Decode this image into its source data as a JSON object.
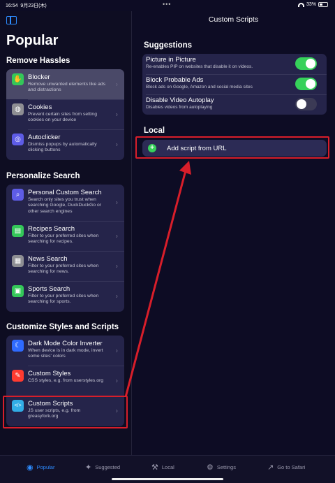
{
  "status": {
    "time": "16:54",
    "date": "9月23日(木)",
    "battery": "33%"
  },
  "sidebar": {
    "title": "Popular",
    "sections": [
      {
        "title": "Remove Hassles",
        "items": [
          {
            "title": "Blocker",
            "subtitle": "Remove unwanted elements like ads and distractions",
            "icon": "hand-icon",
            "selected": true
          },
          {
            "title": "Cookies",
            "subtitle": "Prevent certain sites from setting cookies on your device",
            "icon": "globe-icon"
          },
          {
            "title": "Autoclicker",
            "subtitle": "Dismiss popups by automatically clicking buttons",
            "icon": "tap-icon"
          }
        ]
      },
      {
        "title": "Personalize Search",
        "items": [
          {
            "title": "Personal Custom Search",
            "subtitle": "Search only sites you trust when searching Google, DuckDuckGo or other search engines",
            "icon": "search-icon"
          },
          {
            "title": "Recipes Search",
            "subtitle": "Filter to your preferred sites when searching for recipes.",
            "icon": "recipe-icon"
          },
          {
            "title": "News Search",
            "subtitle": "Filter to your preferred sites when searching for news.",
            "icon": "news-icon"
          },
          {
            "title": "Sports Search",
            "subtitle": "Filter to your preferred sites when searching for sports.",
            "icon": "sports-icon"
          }
        ]
      },
      {
        "title": "Customize Styles and Scripts",
        "items": [
          {
            "title": "Dark Mode Color Inverter",
            "subtitle": "When device is in dark mode, invert some sites' colors",
            "icon": "moon-icon"
          },
          {
            "title": "Custom Styles",
            "subtitle": "CSS styles, e.g. from userstyles.org",
            "icon": "brush-icon"
          },
          {
            "title": "Custom Scripts",
            "subtitle": "JS user scripts, e.g. from greasyfork.org",
            "icon": "code-icon"
          }
        ]
      }
    ]
  },
  "main": {
    "title": "Custom Scripts",
    "suggestions_title": "Suggestions",
    "suggestions": [
      {
        "title": "Picture in Picture",
        "subtitle": "Re-enables PIP on websites that disable it on videos.",
        "enabled": true
      },
      {
        "title": "Block Probable Ads",
        "subtitle": "Block ads on Google, Amazon and social media sites",
        "enabled": true
      },
      {
        "title": "Disable Video Autoplay",
        "subtitle": "Disables videos from autoplaying",
        "enabled": false
      }
    ],
    "local_title": "Local",
    "add_label": "Add script from URL"
  },
  "tabs": [
    {
      "label": "Popular",
      "icon": "compass-icon",
      "active": true
    },
    {
      "label": "Suggested",
      "icon": "sparkle-icon"
    },
    {
      "label": "Local",
      "icon": "tools-icon"
    },
    {
      "label": "Settings",
      "icon": "gear-icon"
    },
    {
      "label": "Go to Safari",
      "icon": "arrow-out-icon"
    }
  ],
  "colors": {
    "accent": "#2d8cff",
    "toggle_on": "#36d15a",
    "highlight": "#d81e2a",
    "blocker": "#34c759",
    "cookies": "#8e8e93",
    "autoclicker": "#5e5ce6",
    "search": "#5e5ce6",
    "recipes": "#34c759",
    "news": "#8e8e93",
    "sports": "#34c759",
    "darkmode": "#2f6bff",
    "styles": "#ff3b30",
    "scripts": "#32ade6"
  }
}
